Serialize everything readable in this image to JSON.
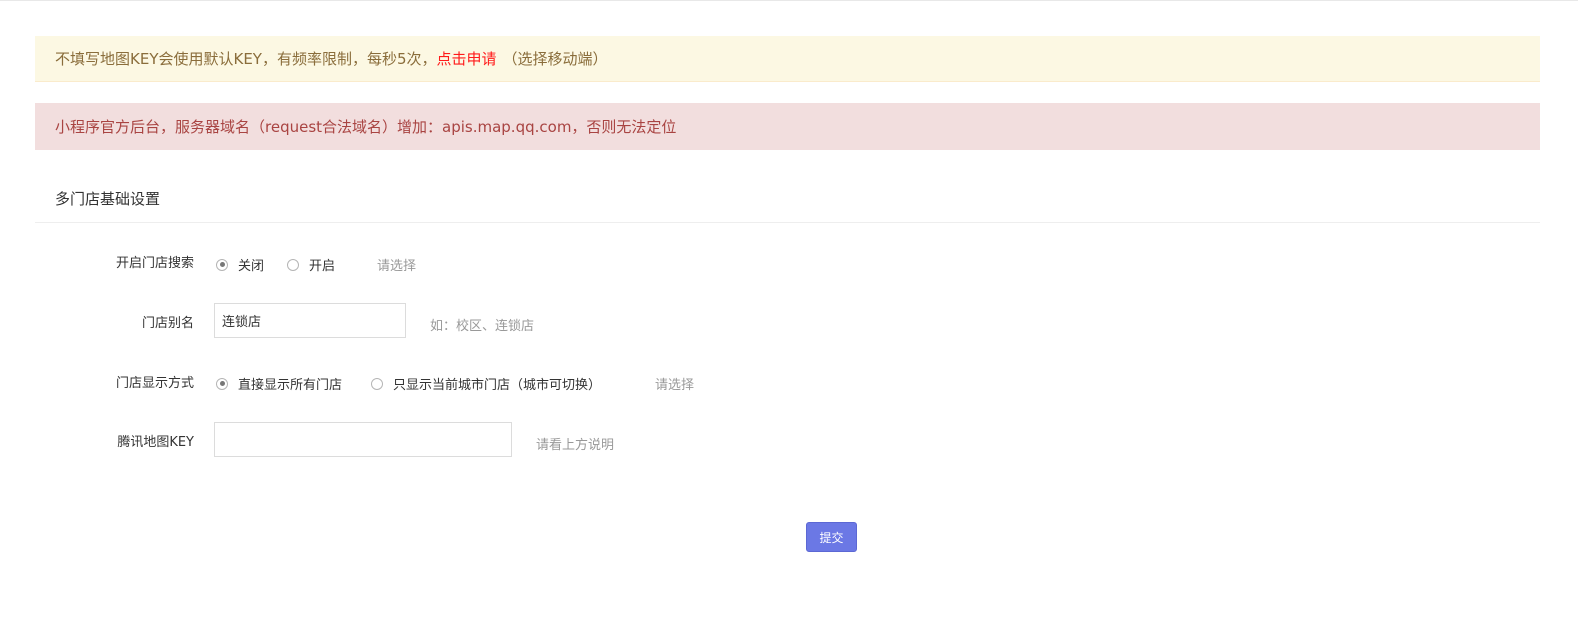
{
  "alerts": {
    "warning_text": "不填写地图KEY会使用默认KEY，有频率限制，每秒5次，",
    "warning_link": "点击申请",
    "warning_suffix": "（选择移动端）",
    "danger_text": "小程序官方后台，服务器域名（request合法域名）增加：apis.map.qq.com，否则无法定位"
  },
  "section": {
    "title": "多门店基础设置"
  },
  "form": {
    "store_search": {
      "label": "开启门店搜索",
      "options": [
        "关闭",
        "开启"
      ],
      "selected": "关闭",
      "hint": "请选择"
    },
    "store_alias": {
      "label": "门店别名",
      "value": "连锁店",
      "hint": "如：校区、连锁店"
    },
    "display_mode": {
      "label": "门店显示方式",
      "options": [
        "直接显示所有门店",
        "只显示当前城市门店（城市可切换）"
      ],
      "selected": "直接显示所有门店",
      "hint": "请选择"
    },
    "map_key": {
      "label": "腾讯地图KEY",
      "value": "",
      "hint": "请看上方说明"
    },
    "submit_label": "提交"
  },
  "colors": {
    "warning_bg": "#fcf8e3",
    "warning_text": "#8a6d3b",
    "link": "#ff1a1a",
    "danger_bg": "#f2dede",
    "danger_text": "#a94442",
    "primary_button": "#6b78e5"
  }
}
